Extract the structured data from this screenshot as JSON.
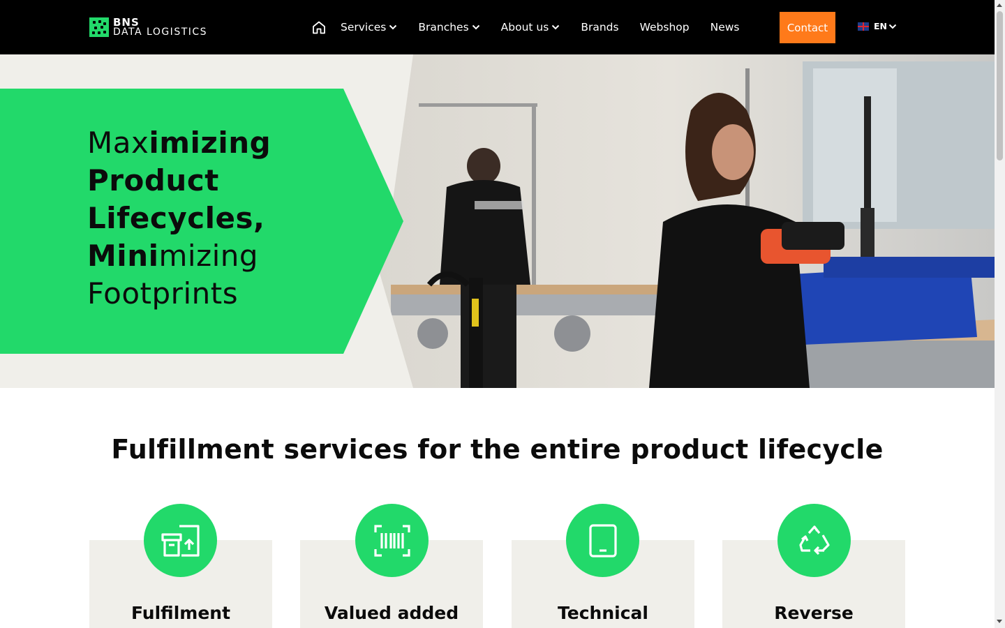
{
  "header": {
    "logo_line1": "BNS",
    "logo_line2": "DATA LOGISTICS",
    "nav": [
      {
        "label": "Services",
        "has_dropdown": true
      },
      {
        "label": "Branches",
        "has_dropdown": true
      },
      {
        "label": "About us",
        "has_dropdown": true
      },
      {
        "label": "Brands",
        "has_dropdown": false
      },
      {
        "label": "Webshop",
        "has_dropdown": false
      },
      {
        "label": "News",
        "has_dropdown": false
      }
    ],
    "contact_label": "Contact",
    "language": "EN",
    "home_icon": "home-icon",
    "flag_icon": "uk-flag-icon"
  },
  "hero": {
    "line1_light": "Max",
    "line1_bold": "imizing",
    "line2": "Product",
    "line3": "Lifecycles,",
    "line4_bold": "Mini",
    "line4_light": "mizing",
    "line5": "Footprints"
  },
  "services": {
    "title": "Fulfillment services for the entire product lifecycle",
    "cards": [
      {
        "title": "Fulfilment",
        "icon": "box-upload-icon"
      },
      {
        "title": "Valued added",
        "icon": "barcode-scan-icon"
      },
      {
        "title": "Technical",
        "icon": "tablet-icon"
      },
      {
        "title": "Reverse",
        "icon": "recycle-icon"
      }
    ]
  },
  "colors": {
    "brand_green": "#22d96a",
    "header_bg": "#000000",
    "contact_orange": "#ff7a1a",
    "card_bg": "#f0efea"
  }
}
